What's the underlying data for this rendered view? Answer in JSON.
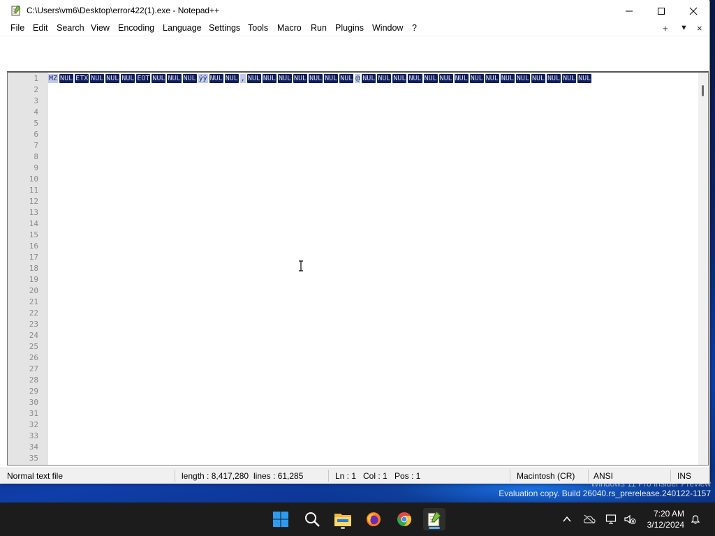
{
  "window": {
    "title": "C:\\Users\\vm6\\Desktop\\error422(1).exe - Notepad++"
  },
  "menubar": {
    "items": [
      "File",
      "Edit",
      "Search",
      "View",
      "Encoding",
      "Language",
      "Settings",
      "Tools",
      "Macro",
      "Run",
      "Plugins",
      "Window",
      "?"
    ],
    "right_add": "+",
    "right_dropdown": "▼",
    "right_close": "×"
  },
  "editor": {
    "line_numbers": [
      "1",
      "2",
      "3",
      "4",
      "5",
      "6",
      "7",
      "8",
      "9",
      "10",
      "11",
      "12",
      "13",
      "14",
      "15",
      "16",
      "17",
      "18",
      "19",
      "20",
      "21",
      "22",
      "23",
      "24",
      "25",
      "26",
      "27",
      "28",
      "29",
      "30",
      "31",
      "32",
      "33",
      "34",
      "35"
    ],
    "line1_tokens": [
      {
        "t": "MZ",
        "k": "plain"
      },
      {
        "t": "NUL",
        "k": "seg"
      },
      {
        "t": "ETX",
        "k": "seg"
      },
      {
        "t": "NUL",
        "k": "seg"
      },
      {
        "t": "NUL",
        "k": "seg"
      },
      {
        "t": "NUL",
        "k": "seg"
      },
      {
        "t": "EOT",
        "k": "seg"
      },
      {
        "t": "NUL",
        "k": "seg"
      },
      {
        "t": "NUL",
        "k": "seg"
      },
      {
        "t": "NUL",
        "k": "seg"
      },
      {
        "t": "ÿÿ",
        "k": "plain"
      },
      {
        "t": "NUL",
        "k": "seg"
      },
      {
        "t": "NUL",
        "k": "seg"
      },
      {
        "t": ",",
        "k": "plain"
      },
      {
        "t": "NUL",
        "k": "seg"
      },
      {
        "t": "NUL",
        "k": "seg"
      },
      {
        "t": "NUL",
        "k": "seg"
      },
      {
        "t": "NUL",
        "k": "seg"
      },
      {
        "t": "NUL",
        "k": "seg"
      },
      {
        "t": "NUL",
        "k": "seg"
      },
      {
        "t": "NUL",
        "k": "seg"
      },
      {
        "t": "@",
        "k": "plain"
      },
      {
        "t": "NUL",
        "k": "seg"
      },
      {
        "t": "NUL",
        "k": "seg"
      },
      {
        "t": "NUL",
        "k": "seg"
      },
      {
        "t": "NUL",
        "k": "seg"
      },
      {
        "t": "NUL",
        "k": "seg"
      },
      {
        "t": "NUL",
        "k": "seg"
      },
      {
        "t": "NUL",
        "k": "seg"
      },
      {
        "t": "NUL",
        "k": "seg"
      },
      {
        "t": "NUL",
        "k": "seg"
      },
      {
        "t": "NUL",
        "k": "seg"
      },
      {
        "t": "NUL",
        "k": "seg"
      },
      {
        "t": "NUL",
        "k": "seg"
      },
      {
        "t": "NUL",
        "k": "seg"
      },
      {
        "t": "NUL",
        "k": "seg"
      },
      {
        "t": "NUL",
        "k": "seg"
      }
    ]
  },
  "statusbar": {
    "file_type": "Normal text file",
    "length": "length : 8,417,280",
    "lines": "lines : 61,285",
    "ln": "Ln : 1",
    "col": "Col : 1",
    "pos": "Pos : 1",
    "eol": "Macintosh (CR)",
    "encoding": "ANSI",
    "mode": "INS"
  },
  "desktop": {
    "watermark_line1": "Windows 11 Pro Insider Preview",
    "watermark_line2": "Evaluation copy. Build 26040.rs_prerelease.240122-1157"
  },
  "taskbar": {
    "apps": [
      "start-icon",
      "search-icon",
      "file-explorer-icon",
      "firefox-icon",
      "chrome-icon",
      "notepadpp-icon"
    ],
    "time": "7:20 AM",
    "date": "3/12/2024"
  },
  "colors": {
    "selection_bg": "#0f1d5c",
    "gutter_bg": "#e4e4e4",
    "taskbar_bg": "#1c1c1c",
    "accent": "#5fb2f2"
  }
}
